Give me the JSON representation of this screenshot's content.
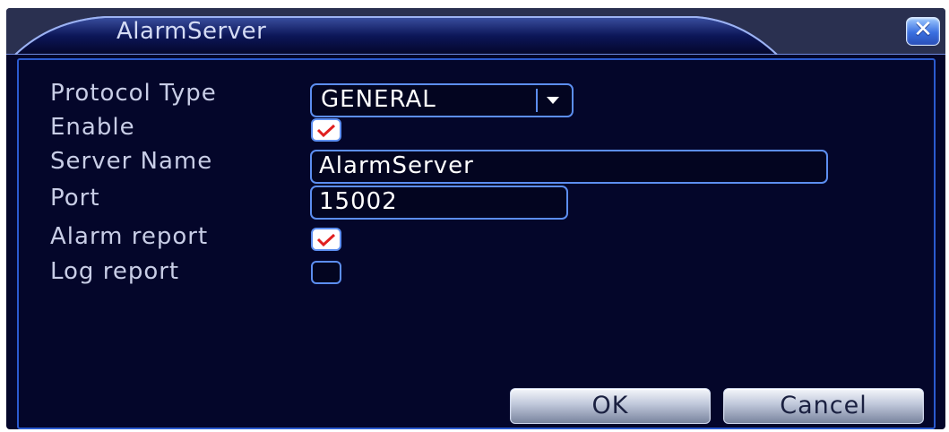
{
  "window": {
    "title": "AlarmServer",
    "close_icon": "close-icon"
  },
  "form": {
    "protocol_type": {
      "label": "Protocol Type",
      "value": "GENERAL"
    },
    "enable": {
      "label": "Enable",
      "checked": true
    },
    "server_name": {
      "label": "Server Name",
      "value": "AlarmServer"
    },
    "port": {
      "label": "Port",
      "value": "15002"
    },
    "alarm_report": {
      "label": "Alarm report",
      "checked": true
    },
    "log_report": {
      "label": "Log report",
      "checked": false
    }
  },
  "buttons": {
    "ok": "OK",
    "cancel": "Cancel"
  },
  "colors": {
    "background": "#04062a",
    "accent": "#2b5bd0",
    "check": "#e02020"
  }
}
